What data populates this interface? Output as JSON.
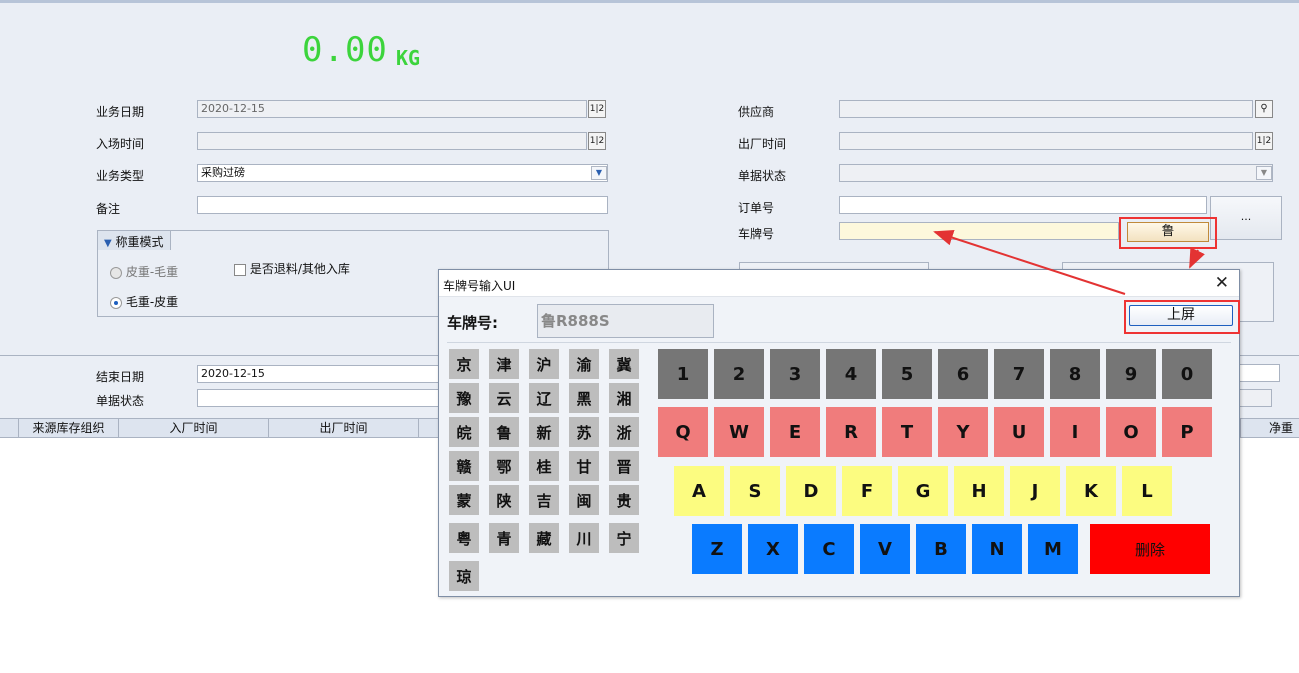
{
  "weight": {
    "value": "0.00",
    "unit": "KG"
  },
  "form_left": {
    "biz_date_label": "业务日期",
    "biz_date_value": "2020-12-15",
    "entry_time_label": "入场时间",
    "entry_time_value": "",
    "biz_type_label": "业务类型",
    "biz_type_value": "采购过磅",
    "remark_label": "备注",
    "remark_value": "",
    "calendar_icon_text": "1|2"
  },
  "form_right": {
    "supplier_label": "供应商",
    "supplier_value": "",
    "exit_time_label": "出厂时间",
    "exit_time_value": "",
    "doc_status_label": "单据状态",
    "doc_status_value": "",
    "order_no_label": "订单号",
    "order_no_value": "",
    "plate_label": "车牌号",
    "plate_value": "",
    "ellipsis_button": "...",
    "province_button": "鲁"
  },
  "weigh_mode": {
    "title": "称重模式",
    "option1": "皮重-毛重",
    "option2": "毛重-皮重",
    "selected": "毛重-皮重",
    "return_checkbox": "是否退料/其他入库"
  },
  "filter": {
    "end_date_label": "结束日期",
    "end_date_value": "2020-12-15",
    "doc_status_label": "单据状态",
    "doc_status_value": ""
  },
  "grid": {
    "columns": [
      "来源库存组织",
      "入厂时间",
      "出厂时间"
    ],
    "last_column": "净重"
  },
  "dialog": {
    "title": "车牌号输入UI",
    "close": "✕",
    "plate_label": "车牌号:",
    "plate_value": "鲁R888S",
    "submit_button": "上屏",
    "provinces": [
      "京",
      "津",
      "沪",
      "渝",
      "冀",
      "豫",
      "云",
      "辽",
      "黑",
      "湘",
      "皖",
      "鲁",
      "新",
      "苏",
      "浙",
      "赣",
      "鄂",
      "桂",
      "甘",
      "晋",
      "蒙",
      "陕",
      "吉",
      "闽",
      "贵",
      "粤",
      "青",
      "藏",
      "川",
      "宁",
      "琼"
    ],
    "digits": [
      "1",
      "2",
      "3",
      "4",
      "5",
      "6",
      "7",
      "8",
      "9",
      "0"
    ],
    "row_q": [
      "Q",
      "W",
      "E",
      "R",
      "T",
      "Y",
      "U",
      "I",
      "O",
      "P"
    ],
    "row_a": [
      "A",
      "S",
      "D",
      "F",
      "G",
      "H",
      "J",
      "K",
      "L"
    ],
    "row_z": [
      "Z",
      "X",
      "C",
      "V",
      "B",
      "N",
      "M"
    ],
    "delete_button": "删除"
  },
  "colors": {
    "weight_green": "#3cd43c",
    "digit_key": "#767676",
    "q_row": "#f07c7c",
    "a_row": "#fcfc80",
    "z_row": "#0a7bff",
    "delete": "#ff0000",
    "annotation_red": "#e33333"
  }
}
